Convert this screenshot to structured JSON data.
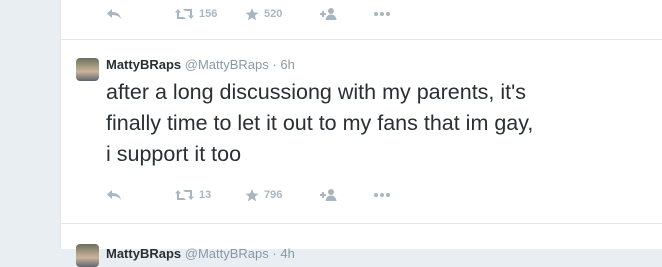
{
  "tweets": [
    {
      "actions": {
        "retweets": "156",
        "favorites": "520"
      }
    },
    {
      "name": "MattyBRaps",
      "handle": "@MattyBRaps",
      "separator": "·",
      "time": "6h",
      "text": "after a long discussiong with my parents, it's\nfinally time to let it out to my fans that im gay,\ni support it too",
      "actions": {
        "retweets": "13",
        "favorites": "796"
      }
    },
    {
      "name": "MattyBRaps",
      "handle": "@MattyBRaps",
      "separator": "·",
      "time": "4h"
    }
  ],
  "icons": {
    "reply": "reply-icon",
    "retweet": "retweet-icon",
    "favorite": "star-icon",
    "follow": "follow-icon",
    "more": "more-icon"
  },
  "colors": {
    "background": "#e9eef2",
    "card": "#ffffff",
    "name": "#292f33",
    "muted": "#8899a6",
    "action_icon": "#a9b6c0"
  }
}
